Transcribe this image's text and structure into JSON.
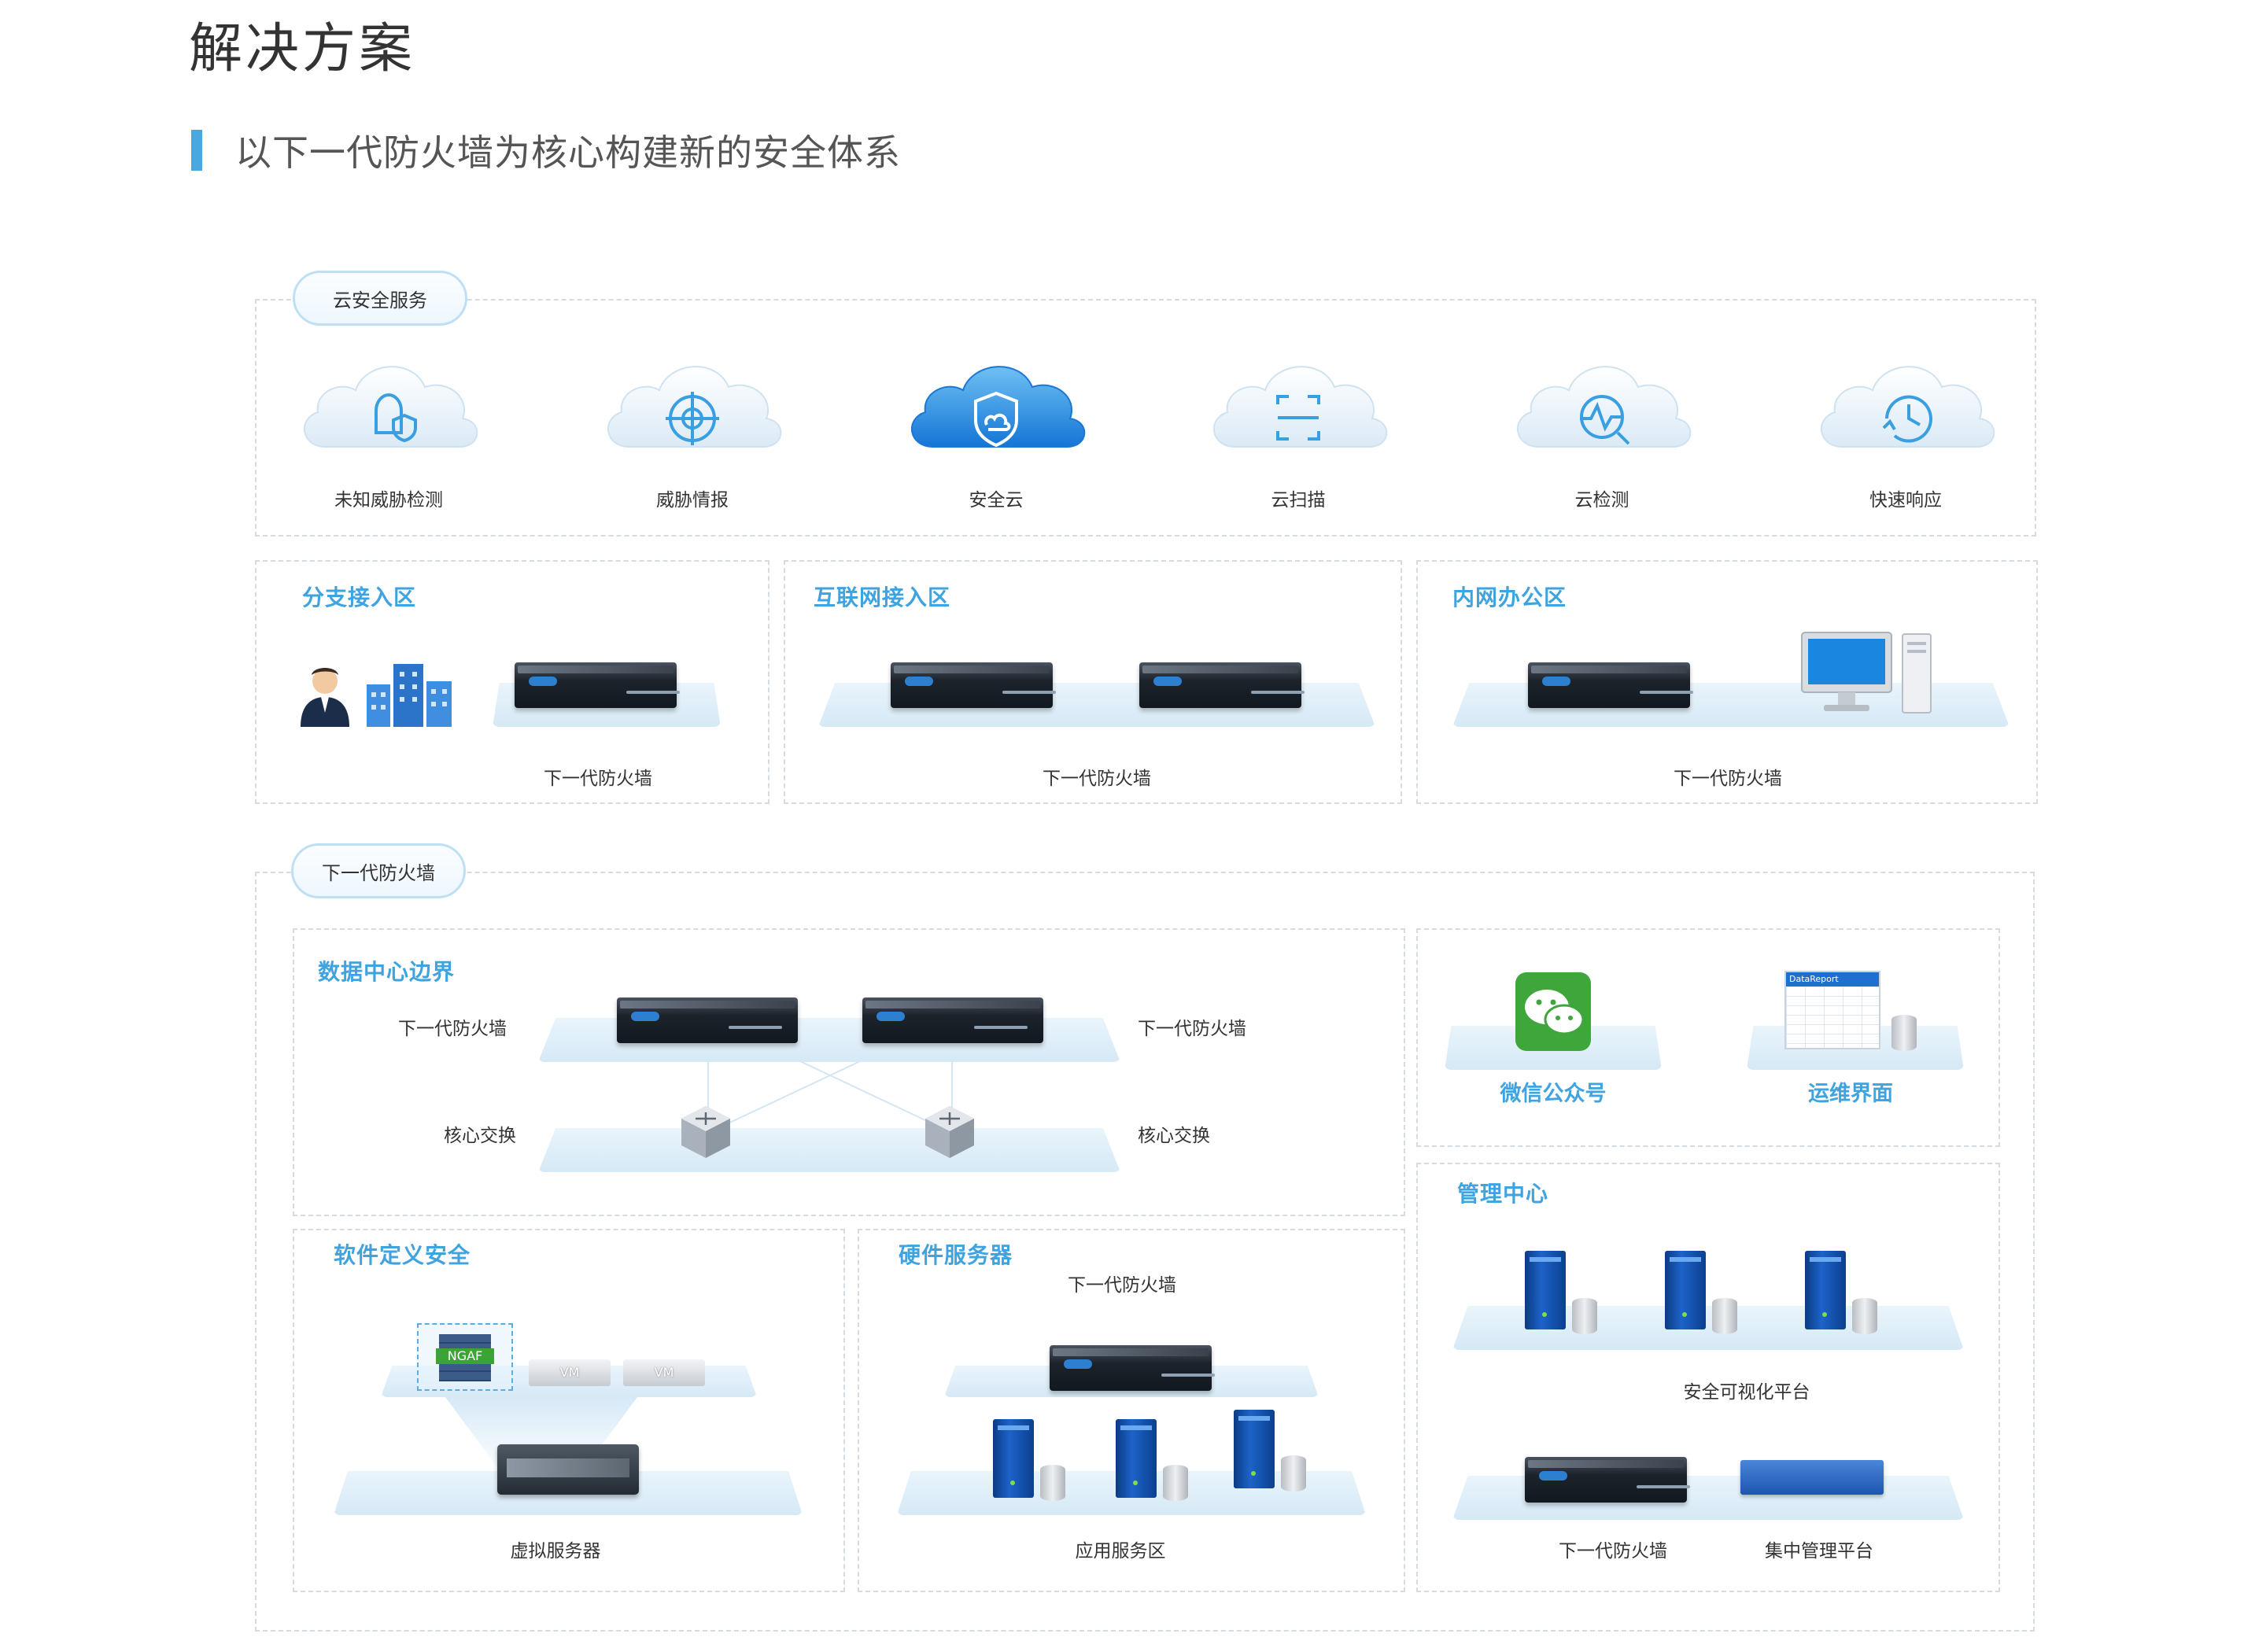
{
  "page": {
    "title": "解决方案",
    "subtitle": "以下一代防火墙为核心构建新的安全体系",
    "accent": "#3fa3e0"
  },
  "cloud_section": {
    "pill": "云安全服务",
    "items": [
      {
        "label": "未知威胁检测",
        "icon": "bell-shield-icon"
      },
      {
        "label": "威胁情报",
        "icon": "target-icon"
      },
      {
        "label": "安全云",
        "icon": "shield-cloud-icon",
        "highlight": true
      },
      {
        "label": "云扫描",
        "icon": "scan-frame-icon"
      },
      {
        "label": "云检测",
        "icon": "pulse-search-icon"
      },
      {
        "label": "快速响应",
        "icon": "clock-icon"
      }
    ]
  },
  "zones": {
    "branch": {
      "title": "分支接入区",
      "caption": "下一代防火墙"
    },
    "internet": {
      "title": "互联网接入区",
      "caption": "下一代防火墙"
    },
    "office": {
      "title": "内网办公区",
      "caption": "下一代防火墙"
    }
  },
  "ngfw_section": {
    "pill": "下一代防火墙",
    "datacenter": {
      "title": "数据中心边界",
      "fw_left": "下一代防火墙",
      "fw_right": "下一代防火墙",
      "sw_left": "核心交换",
      "sw_right": "核心交换"
    },
    "apps": {
      "wechat": "微信公众号",
      "ops": "运维界面",
      "report_label": "DataReport"
    },
    "sds": {
      "title": "软件定义安全",
      "ngaf": "NGAF",
      "vm1": "VM",
      "vm2": "VM",
      "caption": "虚拟服务器"
    },
    "hw": {
      "title": "硬件服务器",
      "fw_caption": "下一代防火墙",
      "caption": "应用服务区"
    },
    "mgmt": {
      "title": "管理中心",
      "vis_caption": "安全可视化平台",
      "fw_caption": "下一代防火墙",
      "cmp_caption": "集中管理平台"
    }
  }
}
